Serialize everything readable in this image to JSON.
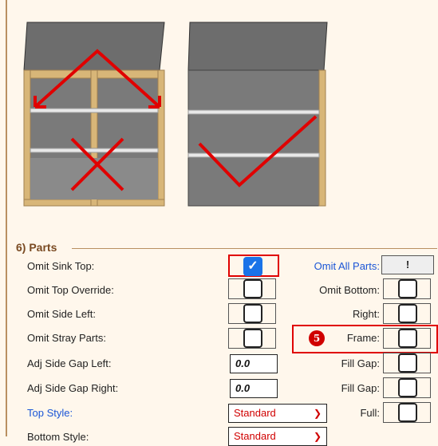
{
  "section": {
    "title": "6) Parts"
  },
  "rows": {
    "omit_sink_top": "Omit Sink Top:",
    "omit_top_override": "Omit Top Override:",
    "omit_side_left": "Omit Side Left:",
    "omit_stray_parts": "Omit Stray Parts:",
    "adj_side_gap_left": "Adj Side Gap Left:",
    "adj_side_gap_right": "Adj Side Gap Right:",
    "top_style": "Top Style:",
    "bottom_style": "Bottom Style:"
  },
  "values": {
    "adj_side_gap_left": "0.0",
    "adj_side_gap_right": "0.0",
    "top_style": "Standard",
    "bottom_style": "Standard",
    "omit_sink_top_checked": true
  },
  "right_column": {
    "omit_all_parts": "Omit All Parts:",
    "omit_all_button": "!",
    "omit_bottom": "Omit Bottom:",
    "right": "Right:",
    "frame": "Frame:",
    "fill_gap_1": "Fill Gap:",
    "fill_gap_2": "Fill Gap:",
    "full": "Full:"
  },
  "annotation": {
    "step_badge": "5"
  },
  "colors": {
    "accent_red": "#e00000",
    "link_blue": "#1a55d6",
    "checkbox_blue": "#1a73e8"
  }
}
